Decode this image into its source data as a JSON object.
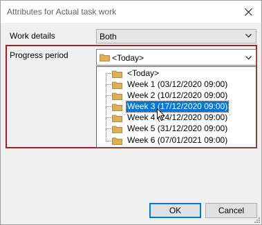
{
  "window": {
    "title": "Attributes for Actual task work"
  },
  "work_details": {
    "label": "Work details",
    "value": "Both"
  },
  "progress_period": {
    "label": "Progress period",
    "value": "<Today>",
    "options": [
      "<Today>",
      "Week 1 (03/12/2020 09:00)",
      "Week 2 (10/12/2020 09:00)",
      "Week 3 (17/12/2020 09:00)",
      "Week 4 (24/12/2020 09:00)",
      "Week 5 (31/12/2020 09:00)",
      "Week 6 (07/01/2021 09:00)"
    ],
    "selected_option": "Week 3 (17/12/2020 09:00)"
  },
  "buttons": {
    "ok": "OK",
    "cancel": "Cancel"
  },
  "colors": {
    "highlight_frame": "#a3202b",
    "selection": "#0078d7",
    "folder": "#dcb05a"
  }
}
